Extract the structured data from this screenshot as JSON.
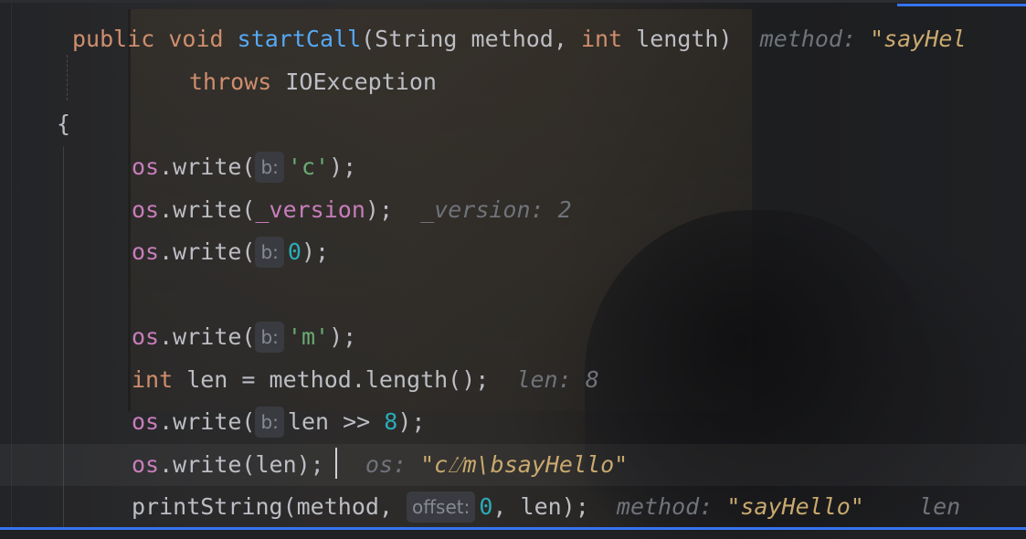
{
  "editor": {
    "line1": {
      "kw_public": "public",
      "kw_void": "void",
      "method_name": "startCall",
      "params_a": "(String method, ",
      "kw_int": "int",
      "params_b": " length)",
      "inline_label": "method: ",
      "inline_value": "\"sayHel"
    },
    "line2": {
      "kw_throws": "throws",
      "exception": " IOException"
    },
    "line3": {
      "brace": "{"
    },
    "line4": {
      "field": "os",
      "call": ".write(",
      "hint": "b:",
      "arg": "'c'",
      "end": ");"
    },
    "line5": {
      "field": "os",
      "call": ".write(",
      "arg": "_version",
      "end": ");",
      "inline_label": "_version: 2"
    },
    "line6": {
      "field": "os",
      "call": ".write(",
      "hint": "b:",
      "arg": "0",
      "end": ");"
    },
    "line8": {
      "field": "os",
      "call": ".write(",
      "hint": "b:",
      "arg": "'m'",
      "end": ");"
    },
    "line9": {
      "kw_int": "int",
      "rest": " len = method.length();",
      "inline_label": "len: 8"
    },
    "line10": {
      "field": "os",
      "call": ".write(",
      "hint": "b:",
      "arg_a": "len >> ",
      "arg_num": "8",
      "end": ");"
    },
    "line11": {
      "field": "os",
      "call": ".write(len);",
      "inline_label": "os: ",
      "inline_value": "\"c⌰m\\bsayHello\""
    },
    "line12": {
      "call": "printString(method, ",
      "hint": "offset:",
      "arg_num": "0",
      "end": ", len);",
      "inline_label": "method: ",
      "inline_value": "\"sayHello\"",
      "inline_label_2": "len"
    }
  }
}
